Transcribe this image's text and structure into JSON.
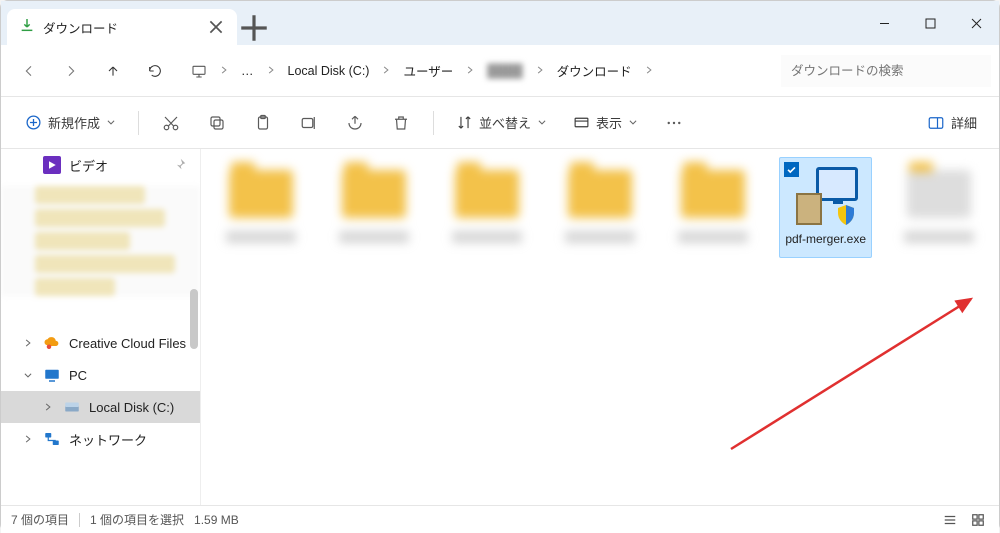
{
  "window": {
    "tab_title": "ダウンロード",
    "search_placeholder": "ダウンロードの検索"
  },
  "breadcrumb": {
    "items": [
      "Local Disk (C:)",
      "ユーザー",
      "",
      "ダウンロード"
    ],
    "blurred_index": 2
  },
  "toolbar": {
    "new_label": "新規作成",
    "sort_label": "並べ替え",
    "view_label": "表示",
    "details_label": "詳細"
  },
  "sidebar": {
    "video": "ビデオ",
    "ccf": "Creative Cloud Files",
    "pc": "PC",
    "localdisk": "Local Disk (C:)",
    "network": "ネットワーク"
  },
  "content": {
    "selected_file": "pdf-merger.exe"
  },
  "statusbar": {
    "count": "7 個の項目",
    "selection": "1 個の項目を選択",
    "size": "1.59 MB"
  }
}
